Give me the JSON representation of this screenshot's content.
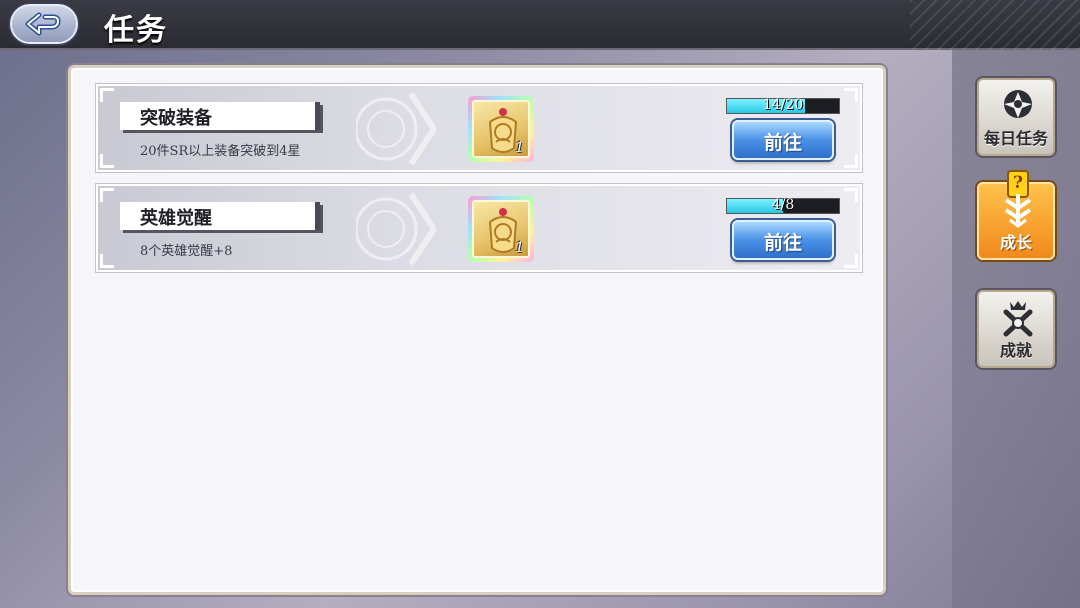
{
  "header": {
    "title": "任务"
  },
  "tasks": [
    {
      "title": "突破装备",
      "description": "20件SR以上装备突破到4星",
      "reward_count": "1",
      "progress_text": "14/20",
      "progress_fraction": 0.7,
      "go_label": "前往"
    },
    {
      "title": "英雄觉醒",
      "description": "8个英雄觉醒+8",
      "reward_count": "1",
      "progress_text": "4/8",
      "progress_fraction": 0.5,
      "go_label": "前往"
    }
  ],
  "side_tabs": [
    {
      "label": "每日任务",
      "icon": "daily-task-icon",
      "active": false
    },
    {
      "label": "成长",
      "icon": "growth-icon",
      "active": true,
      "badge": "?"
    },
    {
      "label": "成就",
      "icon": "achievement-icon",
      "active": false
    }
  ],
  "colors": {
    "progress_fill": "#29c7e6",
    "go_button": "#4a91e6",
    "active_tab": "#f0891c"
  }
}
